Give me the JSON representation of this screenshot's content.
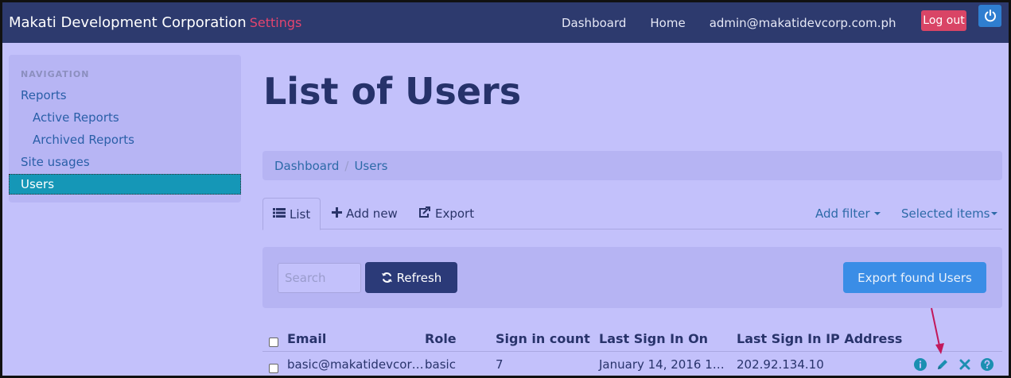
{
  "header": {
    "brand": "Makati Development Corporation",
    "brand_sub": "Settings",
    "nav": [
      "Dashboard",
      "Home",
      "admin@makatidevcorp.com.ph"
    ],
    "logout": "Log out"
  },
  "sidebar": {
    "header": "NAVIGATION",
    "items": [
      {
        "label": "Reports"
      },
      {
        "label": "Active Reports"
      },
      {
        "label": "Archived Reports"
      },
      {
        "label": "Site usages"
      },
      {
        "label": "Users"
      }
    ]
  },
  "main": {
    "title": "List of Users",
    "breadcrumb": [
      "Dashboard",
      "Users"
    ],
    "tabs": {
      "list": "List",
      "add_new": "Add new",
      "export": "Export",
      "add_filter": "Add filter",
      "selected_items": "Selected items"
    },
    "filter": {
      "search_placeholder": "Search",
      "refresh": "Refresh",
      "export_found": "Export found Users"
    },
    "table": {
      "headers": [
        "Email",
        "Role",
        "Sign in count",
        "Last Sign In On",
        "Last Sign In IP Address"
      ],
      "rows": [
        {
          "email": "basic@makatidevcor…",
          "role": "basic",
          "sign_in_count": "7",
          "last_sign_in_on": "January 14, 2016 1…",
          "ip": "202.92.134.10"
        }
      ]
    }
  },
  "colors": {
    "topbar": "#2d3a6e",
    "background": "#c3c1fb",
    "accent": "#1597b7",
    "logout": "#d94566",
    "arrow": "#c2185b"
  }
}
